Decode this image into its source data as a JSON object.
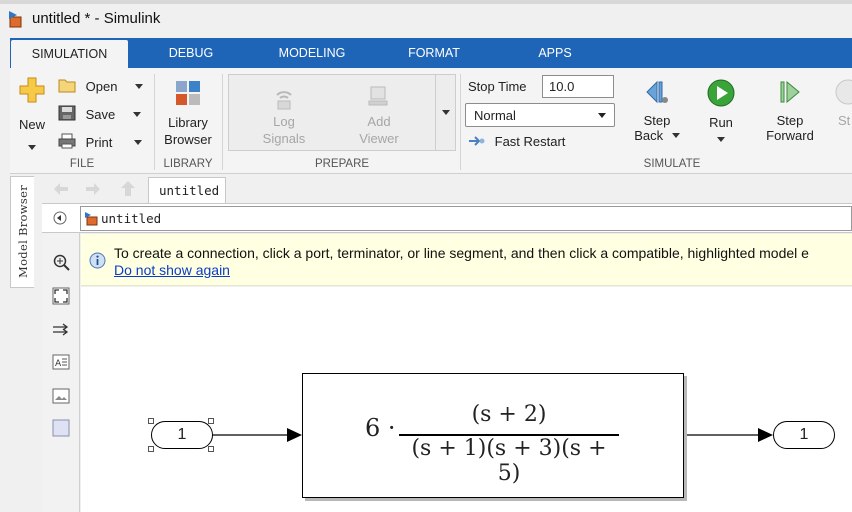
{
  "window": {
    "title": "untitled * - Simulink"
  },
  "tabs": [
    {
      "label": "SIMULATION"
    },
    {
      "label": "DEBUG"
    },
    {
      "label": "MODELING"
    },
    {
      "label": "FORMAT"
    },
    {
      "label": "APPS"
    }
  ],
  "ribbon": {
    "file": {
      "group_label": "FILE",
      "new_label": "New",
      "open_label": "Open",
      "save_label": "Save",
      "print_label": "Print"
    },
    "library": {
      "group_label": "LIBRARY",
      "browser_label_1": "Library",
      "browser_label_2": "Browser"
    },
    "prepare": {
      "group_label": "PREPARE",
      "log_label_1": "Log",
      "log_label_2": "Signals",
      "add_label_1": "Add",
      "add_label_2": "Viewer"
    },
    "simulate": {
      "group_label": "SIMULATE",
      "stop_time_label": "Stop Time",
      "stop_time_value": "10.0",
      "mode_value": "Normal",
      "fast_restart_label": "Fast Restart",
      "step_back_1": "Step",
      "step_back_2": "Back",
      "run_label": "Run",
      "step_forward_1": "Step",
      "step_forward_2": "Forward",
      "stop_partial": "St"
    }
  },
  "model_browser": {
    "label": "Model Browser"
  },
  "nav": {
    "tab_label": "untitled",
    "address": "untitled"
  },
  "banner": {
    "message": "To create a connection, click a port, terminator, or line segment, and then click a compatible, highlighted model e",
    "link": "Do not show again"
  },
  "canvas": {
    "inport_label": "1",
    "outport_label": "1",
    "transfer_fn": {
      "gain": "6 ·",
      "numerator": "(s + 2)",
      "denominator": "(s + 1)(s + 3)(s + 5)"
    }
  }
}
